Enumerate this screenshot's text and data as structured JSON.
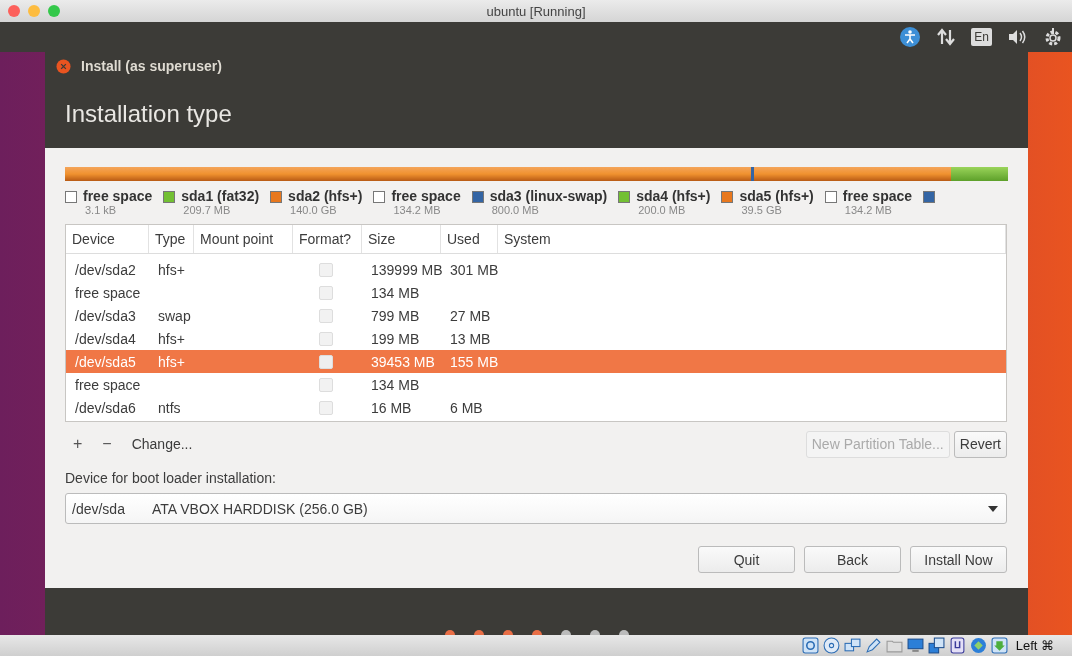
{
  "host_window": {
    "title": "ubuntu [Running]"
  },
  "top_panel": {
    "language": "En"
  },
  "dialog": {
    "title": "Install (as superuser)",
    "heading": "Installation type"
  },
  "legend": [
    {
      "name": "free space",
      "size": "3.1 kB",
      "color": "#ffffff"
    },
    {
      "name": "sda1 (fat32)",
      "size": "209.7 MB",
      "color": "#73c033"
    },
    {
      "name": "sda2 (hfs+)",
      "size": "140.0 GB",
      "color": "#e8781e"
    },
    {
      "name": "free space",
      "size": "134.2 MB",
      "color": "#ffffff"
    },
    {
      "name": "sda3 (linux-swap)",
      "size": "800.0 MB",
      "color": "#3465a4"
    },
    {
      "name": "sda4 (hfs+)",
      "size": "200.0 MB",
      "color": "#73c033"
    },
    {
      "name": "sda5 (hfs+)",
      "size": "39.5 GB",
      "color": "#e8781e"
    },
    {
      "name": "free space",
      "size": "134.2 MB",
      "color": "#ffffff"
    },
    {
      "color": "#3465a4"
    }
  ],
  "table": {
    "columns": [
      "Device",
      "Type",
      "Mount point",
      "Format?",
      "Size",
      "Used",
      "System"
    ],
    "rows": [
      {
        "device": "/dev/sda2",
        "type": "hfs+",
        "size": "139999 MB",
        "used": "301 MB",
        "checked": false,
        "selected": false
      },
      {
        "device": "free space",
        "size": "134 MB",
        "checked": false,
        "selected": false
      },
      {
        "device": "/dev/sda3",
        "type": "swap",
        "size": "799 MB",
        "used": "27 MB",
        "checked": false,
        "selected": false
      },
      {
        "device": "/dev/sda4",
        "type": "hfs+",
        "size": "199 MB",
        "used": "13 MB",
        "checked": false,
        "selected": false
      },
      {
        "device": "/dev/sda5",
        "type": "hfs+",
        "size": "39453 MB",
        "used": "155 MB",
        "checked": false,
        "selected": true
      },
      {
        "device": "free space",
        "size": "134 MB",
        "checked": false,
        "selected": false
      },
      {
        "device": "/dev/sda6",
        "type": "ntfs",
        "size": "16 MB",
        "used": "6 MB",
        "checked": false,
        "selected": false
      }
    ]
  },
  "partition_tools": {
    "add": "+",
    "remove": "−",
    "change": "Change...",
    "new_table": {
      "label": "New Partition Table...",
      "disabled": true
    },
    "revert": "Revert"
  },
  "boot_loader": {
    "label": "Device for boot loader installation:",
    "device": "/dev/sda",
    "description": "ATA VBOX HARDDISK (256.0 GB)"
  },
  "buttons": [
    "Quit",
    "Back",
    "Install Now"
  ],
  "steps": [
    {
      "done": true
    },
    {
      "done": true
    },
    {
      "done": true
    },
    {
      "done": true
    },
    {
      "done": false
    },
    {
      "done": false
    },
    {
      "done": false
    }
  ],
  "status_bar": {
    "host_key": "Left ⌘"
  }
}
